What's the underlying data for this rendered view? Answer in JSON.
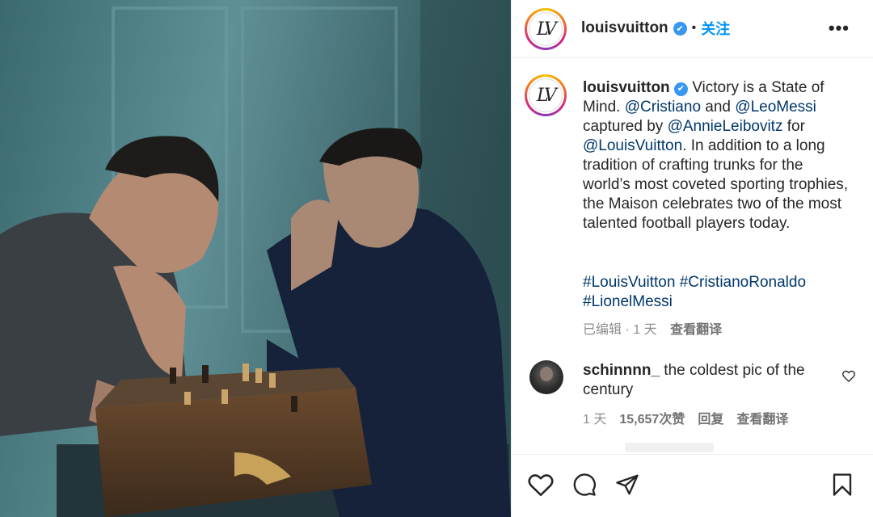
{
  "header": {
    "username": "louisvuitton",
    "verified_mark": "✔",
    "separator": "•",
    "follow_label": "关注",
    "more_label": "•••",
    "avatar_monogram": "LV"
  },
  "caption": {
    "username": "louisvuitton",
    "text_1": "Victory is a State of Mind.",
    "mention_1": "@Cristiano",
    "text_2": "and",
    "mention_2": "@LeoMessi",
    "text_3": "captured by",
    "mention_3": "@AnnieLeibovitz",
    "text_4": "for",
    "mention_4": "@LouisVuitton",
    "text_5": ". In addition to a long tradition of crafting trunks for the world’s most coveted sporting trophies, the Maison celebrates two of the most talented football players today.",
    "hashtags": "#LouisVuitton #CristianoRonaldo #LionelMessi",
    "edited_label": "已编辑",
    "age": "1 天",
    "translate_label": "查看翻译"
  },
  "comment": {
    "username": "schinnnn_",
    "text": "the coldest pic of the century",
    "age": "1 天",
    "likes": "15,657次赞",
    "reply_label": "回复",
    "translate_label": "查看翻译"
  },
  "icons": {
    "like": "heart-icon",
    "comment": "comment-icon",
    "share": "share-icon",
    "save": "bookmark-icon",
    "comment_like": "small-heart-icon"
  },
  "colors": {
    "link": "#0095f6",
    "mention": "#00376b",
    "verified": "#3897f0",
    "muted": "#8e8e8e"
  }
}
